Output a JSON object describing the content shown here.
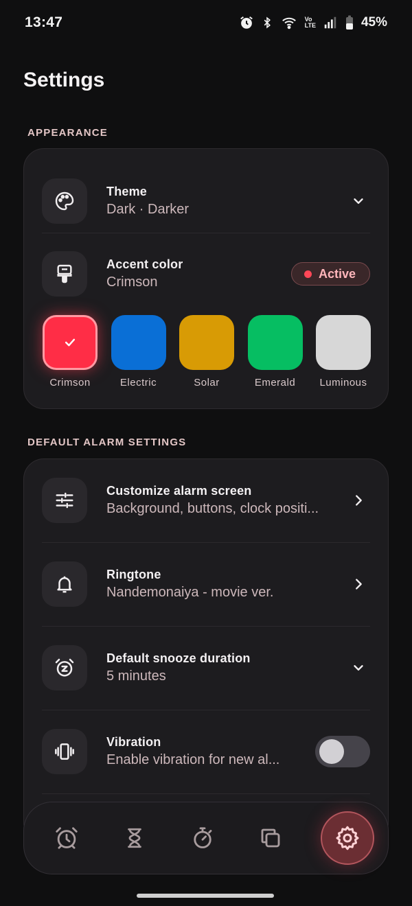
{
  "status_bar": {
    "time": "13:47",
    "battery": "45%",
    "icons": [
      "alarm-icon",
      "bluetooth-icon",
      "wifi-icon",
      "volte-icon",
      "signal-icon",
      "battery-icon"
    ],
    "volte_top": "Vo",
    "volte_bottom": "LTE"
  },
  "page": {
    "title": "Settings"
  },
  "appearance": {
    "section_label": "APPEARANCE",
    "theme": {
      "title": "Theme",
      "value": "Dark · Darker",
      "icon": "palette-icon"
    },
    "accent": {
      "title": "Accent color",
      "value": "Crimson",
      "icon": "paint-roller-icon",
      "badge": "Active",
      "swatches": [
        {
          "label": "Crimson",
          "color": "#ff2d46",
          "selected": true
        },
        {
          "label": "Electric",
          "color": "#0a6fd6",
          "selected": false
        },
        {
          "label": "Solar",
          "color": "#d89b05",
          "selected": false
        },
        {
          "label": "Emerald",
          "color": "#06be62",
          "selected": false
        },
        {
          "label": "Luminous",
          "color": "#d7d7d7",
          "selected": false
        }
      ]
    }
  },
  "alarm_defaults": {
    "section_label": "DEFAULT ALARM SETTINGS",
    "items": [
      {
        "title": "Customize alarm screen",
        "value": "Background, buttons, clock positi...",
        "icon": "sliders-icon",
        "end": "chevron-right-icon"
      },
      {
        "title": "Ringtone",
        "value": "Nandemonaiya - movie ver.",
        "icon": "bell-icon",
        "end": "chevron-right-icon"
      },
      {
        "title": "Default snooze duration",
        "value": "5 minutes",
        "icon": "snooze-icon",
        "end": "chevron-down-icon"
      },
      {
        "title": "Vibration",
        "value": "Enable vibration for new al...",
        "icon": "vibration-icon",
        "toggle_on": false
      }
    ]
  },
  "bottom_nav": {
    "items": [
      "alarm-icon",
      "hourglass-icon",
      "stopwatch-icon",
      "copy-icon",
      "settings-icon"
    ],
    "active": "settings-icon"
  },
  "colors": {
    "accent": "#ff2d46",
    "background": "#0f0f10",
    "card": "#1d1c1f"
  }
}
